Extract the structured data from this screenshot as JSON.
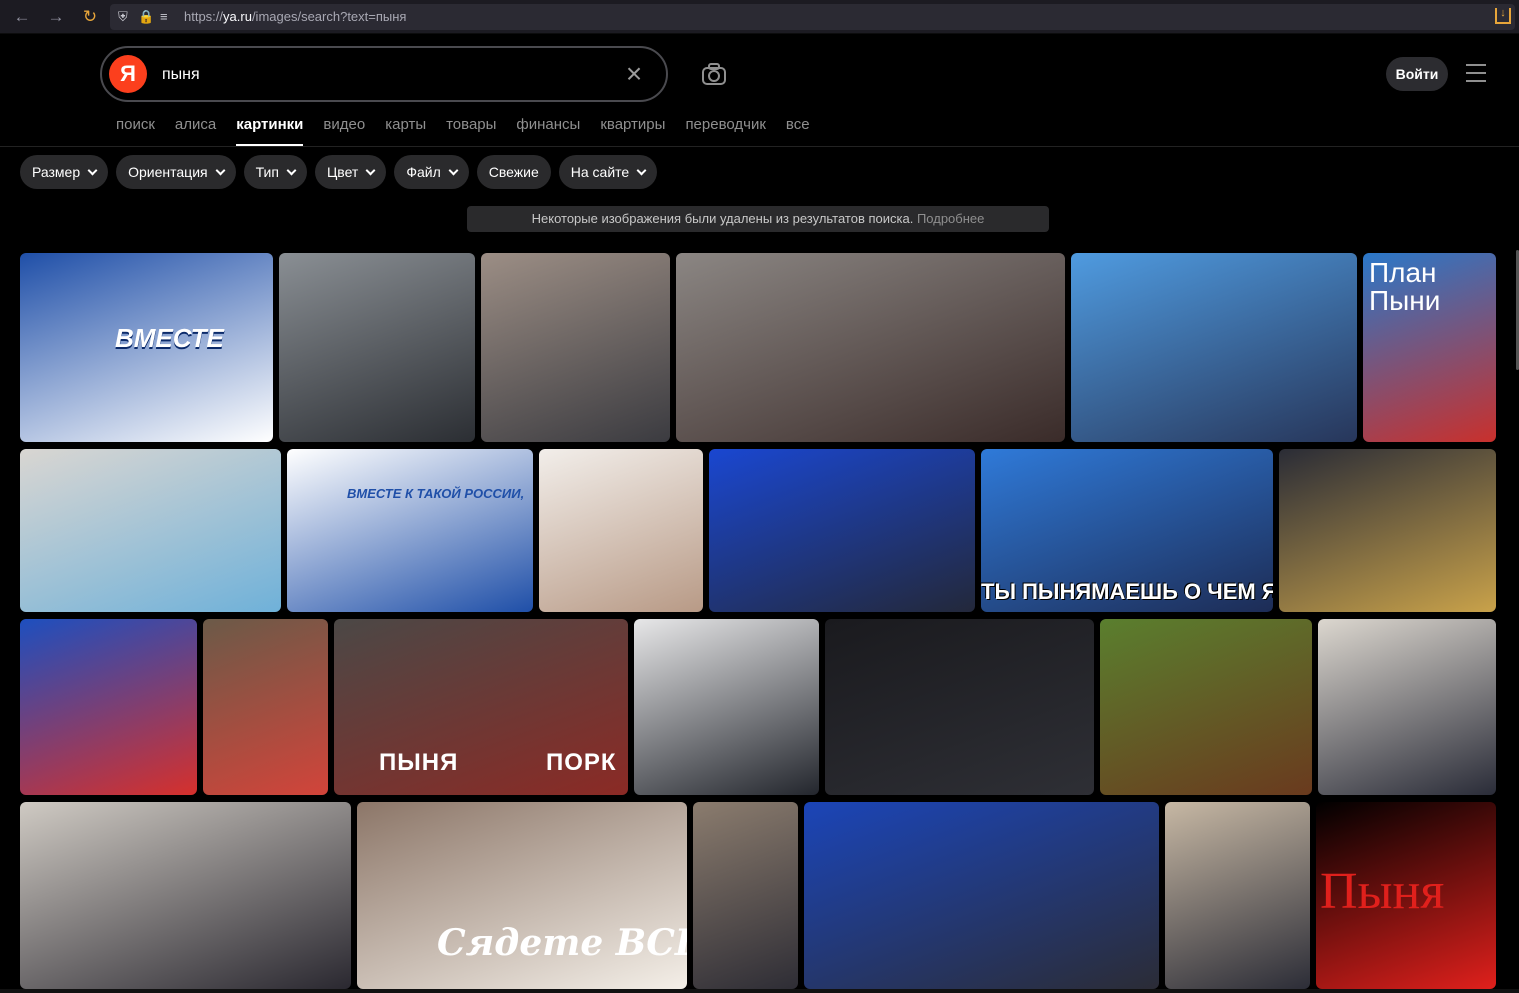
{
  "browser": {
    "url_prefix": "https://",
    "url_host": "ya.ru",
    "url_path": "/images/search?text=пыня"
  },
  "header": {
    "logo_letter": "Я",
    "search_value": "пыня",
    "login_label": "Войти"
  },
  "tabs": [
    {
      "label": "поиск",
      "active": false
    },
    {
      "label": "алиса",
      "active": false
    },
    {
      "label": "картинки",
      "active": true
    },
    {
      "label": "видео",
      "active": false
    },
    {
      "label": "карты",
      "active": false
    },
    {
      "label": "товары",
      "active": false
    },
    {
      "label": "финансы",
      "active": false
    },
    {
      "label": "квартиры",
      "active": false
    },
    {
      "label": "переводчик",
      "active": false
    },
    {
      "label": "все",
      "active": false
    }
  ],
  "filters": [
    {
      "label": "Размер",
      "dropdown": true
    },
    {
      "label": "Ориентация",
      "dropdown": true
    },
    {
      "label": "Тип",
      "dropdown": true
    },
    {
      "label": "Цвет",
      "dropdown": true
    },
    {
      "label": "Файл",
      "dropdown": true
    },
    {
      "label": "Свежие",
      "dropdown": false
    },
    {
      "label": "На сайте",
      "dropdown": true
    }
  ],
  "notice": {
    "text": "Некоторые изображения были удалены из результатов поиска.",
    "link": "Подробнее"
  },
  "results": [
    {
      "caption": "ВМЕСТЕ",
      "colors": [
        "#1f4fa8",
        "#ffffff"
      ]
    },
    {
      "caption": "",
      "colors": [
        "#8a8f94",
        "#2b2e33"
      ]
    },
    {
      "caption": "",
      "colors": [
        "#9c8e85",
        "#3b3b40"
      ]
    },
    {
      "caption": "",
      "colors": [
        "#8b8683",
        "#3a2b29"
      ]
    },
    {
      "caption": "",
      "colors": [
        "#4f9be0",
        "#27365a"
      ]
    },
    {
      "caption": "План Пыни",
      "colors": [
        "#2a78c9",
        "#c9302c"
      ]
    },
    {
      "caption": "",
      "colors": [
        "#d9d6d2",
        "#6fb1d9"
      ]
    },
    {
      "caption": "ВМЕСТЕ К ТАКОЙ РОССИИ,",
      "colors": [
        "#ffffff",
        "#1f4fa8"
      ]
    },
    {
      "caption": "",
      "colors": [
        "#f2eeea",
        "#b89a86"
      ]
    },
    {
      "caption": "",
      "colors": [
        "#1a47d1",
        "#23283a"
      ]
    },
    {
      "caption": "ТЫ ПЫНЯМАЕШЬ О ЧЕМ Я?",
      "colors": [
        "#2f7ad9",
        "#1d2c55"
      ]
    },
    {
      "caption": "",
      "colors": [
        "#2a2c36",
        "#c9a24a"
      ]
    },
    {
      "caption": "",
      "colors": [
        "#1d4fbf",
        "#d6302c"
      ]
    },
    {
      "caption": "",
      "colors": [
        "#6b5a48",
        "#d2443a"
      ]
    },
    {
      "caption": "ПЫНЯ   ПОРК",
      "colors": [
        "#4b4846",
        "#8b2a25"
      ]
    },
    {
      "caption": "",
      "colors": [
        "#e7e7e8",
        "#23262d"
      ]
    },
    {
      "caption": "",
      "colors": [
        "#1a1a1e",
        "#2e2f35"
      ]
    },
    {
      "caption": "",
      "colors": [
        "#5a7f2e",
        "#6a3a1e"
      ]
    },
    {
      "caption": "",
      "colors": [
        "#dcd7cf",
        "#2a2c38"
      ]
    },
    {
      "caption": "",
      "colors": [
        "#cfcac3",
        "#2a2830"
      ]
    },
    {
      "caption": "Сядете ВСЕ!",
      "colors": [
        "#8c7668",
        "#f4efe8"
      ]
    },
    {
      "caption": "",
      "colors": [
        "#8b7c6e",
        "#2e2d35"
      ]
    },
    {
      "caption": "",
      "colors": [
        "#1b45b8",
        "#2b2c36"
      ]
    },
    {
      "caption": "",
      "colors": [
        "#c7b8a4",
        "#2c2d37"
      ]
    },
    {
      "caption": "Пыня",
      "colors": [
        "#000000",
        "#e0201c"
      ]
    }
  ]
}
